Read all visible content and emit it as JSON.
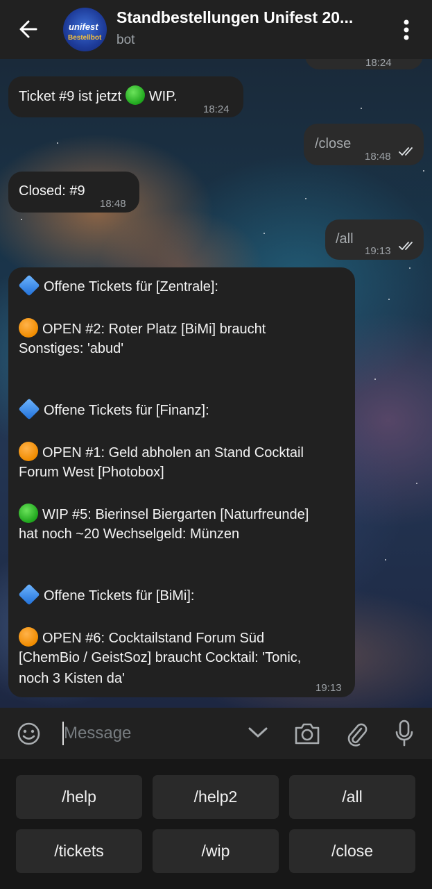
{
  "header": {
    "title": "Standbestellungen Unifest 20...",
    "subtitle": "bot",
    "avatar_text_top": "unifest",
    "avatar_text_bottom": "Bestellbot"
  },
  "messages": [
    {
      "id": "partial",
      "direction": "out",
      "time": "18:24"
    },
    {
      "id": "m1",
      "direction": "in",
      "text_before": "Ticket #9 ist jetzt",
      "status_icon": "green-circle",
      "text_after": "WIP.",
      "time": "18:24"
    },
    {
      "id": "m2",
      "direction": "out",
      "text": "/close",
      "time": "18:48"
    },
    {
      "id": "m3",
      "direction": "in",
      "text": "Closed: #9",
      "time": "18:48"
    },
    {
      "id": "m4",
      "direction": "out",
      "text": "/all",
      "time": "19:13"
    }
  ],
  "overview": {
    "time": "19:13",
    "sections": [
      {
        "header": "Offene Tickets für [Zentrale]:",
        "items": [
          {
            "status_icon": "orange-circle",
            "line1": "OPEN #2: Roter Platz [BiMi] braucht",
            "line2": "Sonstiges: 'abud'",
            "line3": ""
          }
        ]
      },
      {
        "header": "Offene Tickets für [Finanz]:",
        "items": [
          {
            "status_icon": "orange-circle",
            "line1": "OPEN #1: Geld abholen an Stand Cocktail",
            "line2": "Forum West [Photobox]",
            "line3": ""
          },
          {
            "status_icon": "green-circle",
            "line1": "WIP #5: Bierinsel Biergarten [Naturfreunde]",
            "line2": "hat noch ~20 Wechselgeld: Münzen",
            "line3": ""
          }
        ]
      },
      {
        "header": "Offene Tickets für [BiMi]:",
        "items": [
          {
            "status_icon": "orange-circle",
            "line1": "OPEN #6: Cocktailstand Forum Süd",
            "line2": "[ChemBio / GeistSoz] braucht Cocktail: 'Tonic,",
            "line3": "noch 3 Kisten da'"
          }
        ]
      }
    ]
  },
  "composer": {
    "placeholder": "Message"
  },
  "keyboard": {
    "buttons": [
      "/help",
      "/help2",
      "/all",
      "/tickets",
      "/wip",
      "/close"
    ]
  },
  "colors": {
    "header": "#212121",
    "bubble_in": "#212121",
    "bubble_out": "#2b2b2b",
    "keyboard": "#171717",
    "key": "#2a2a2a",
    "accent_green": "#2cb52a",
    "accent_orange": "#f39a12",
    "accent_blue": "#3d8bf0"
  }
}
